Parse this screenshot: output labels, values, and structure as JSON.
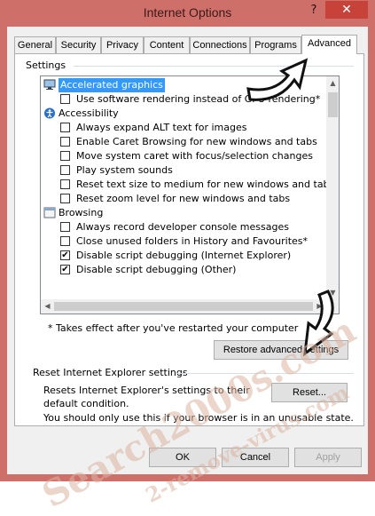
{
  "window": {
    "title": "Internet Options",
    "help_label": "?",
    "close_label": "✕"
  },
  "tabs": [
    {
      "label": "General"
    },
    {
      "label": "Security"
    },
    {
      "label": "Privacy"
    },
    {
      "label": "Content"
    },
    {
      "label": "Connections"
    },
    {
      "label": "Programs"
    },
    {
      "label": "Advanced",
      "active": true
    }
  ],
  "settings": {
    "label": "Settings",
    "items": [
      {
        "kind": "category",
        "icon": "monitor-icon",
        "label": "Accelerated graphics",
        "selected": true
      },
      {
        "kind": "checkbox",
        "label": "Use software rendering instead of GPU rendering*",
        "checked": false
      },
      {
        "kind": "category",
        "icon": "accessibility-icon",
        "label": "Accessibility"
      },
      {
        "kind": "checkbox",
        "label": "Always expand ALT text for images",
        "checked": false
      },
      {
        "kind": "checkbox",
        "label": "Enable Caret Browsing for new windows and tabs",
        "checked": false
      },
      {
        "kind": "checkbox",
        "label": "Move system caret with focus/selection changes",
        "checked": false
      },
      {
        "kind": "checkbox",
        "label": "Play system sounds",
        "checked": false
      },
      {
        "kind": "checkbox",
        "label": "Reset text size to medium for new windows and tabs",
        "checked": false
      },
      {
        "kind": "checkbox",
        "label": "Reset zoom level for new windows and tabs",
        "checked": false
      },
      {
        "kind": "category",
        "icon": "browsing-icon",
        "label": "Browsing"
      },
      {
        "kind": "checkbox",
        "label": "Always record developer console messages",
        "checked": false
      },
      {
        "kind": "checkbox",
        "label": "Close unused folders in History and Favourites*",
        "checked": false
      },
      {
        "kind": "checkbox",
        "label": "Disable script debugging (Internet Explorer)",
        "checked": true
      },
      {
        "kind": "checkbox",
        "label": "Disable script debugging (Other)",
        "checked": true
      }
    ],
    "note": "* Takes effect after you've restarted your computer",
    "restore_label": "Restore advanced settings"
  },
  "reset": {
    "title": "Reset Internet Explorer settings",
    "description": "Resets Internet Explorer's settings to their default condition.",
    "button_label": "Reset...",
    "warning": "You should only use this if your browser is in an unusable state."
  },
  "footer": {
    "ok_label": "OK",
    "cancel_label": "Cancel",
    "apply_label": "Apply"
  },
  "watermark": {
    "line1": "Search2000s.com",
    "line2": "2-remove-virus.com"
  },
  "colors": {
    "frame": "#cf6f6a",
    "close": "#c7433a",
    "selection": "#3399ff"
  }
}
